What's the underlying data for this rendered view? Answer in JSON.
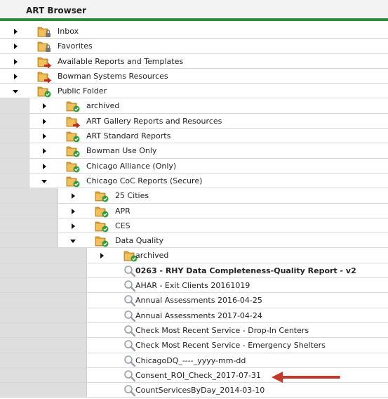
{
  "header": {
    "title": "ART Browser"
  },
  "colors": {
    "accent": "#2f8a3a",
    "annotation_arrow": "#c0392b"
  },
  "tree": [
    {
      "label": "Inbox",
      "level": 0,
      "toggle": "collapsed",
      "icon": "folder-lock-icon"
    },
    {
      "label": "Favorites",
      "level": 0,
      "toggle": "collapsed",
      "icon": "folder-lock-icon"
    },
    {
      "label": "Available Reports and Templates",
      "level": 0,
      "toggle": "collapsed",
      "icon": "folder-redarrow-icon"
    },
    {
      "label": "Bowman Systems Resources",
      "level": 0,
      "toggle": "collapsed",
      "icon": "folder-redarrow-icon"
    },
    {
      "label": "Public Folder",
      "level": 0,
      "toggle": "expanded",
      "icon": "folder-check-icon"
    },
    {
      "label": "archived",
      "level": 1,
      "toggle": "collapsed",
      "icon": "folder-check-icon"
    },
    {
      "label": "ART Gallery Reports and Resources",
      "level": 1,
      "toggle": "collapsed",
      "icon": "folder-redarrow-icon"
    },
    {
      "label": "ART Standard Reports",
      "level": 1,
      "toggle": "collapsed",
      "icon": "folder-check-icon"
    },
    {
      "label": "Bowman Use Only",
      "level": 1,
      "toggle": "collapsed",
      "icon": "folder-check-icon"
    },
    {
      "label": "Chicago Alliance (Only)",
      "level": 1,
      "toggle": "collapsed",
      "icon": "folder-check-icon"
    },
    {
      "label": "Chicago CoC Reports (Secure)",
      "level": 1,
      "toggle": "expanded",
      "icon": "folder-check-icon"
    },
    {
      "label": "25 Cities",
      "level": 2,
      "toggle": "collapsed",
      "icon": "folder-check-icon"
    },
    {
      "label": "APR",
      "level": 2,
      "toggle": "collapsed",
      "icon": "folder-check-icon"
    },
    {
      "label": "CES",
      "level": 2,
      "toggle": "collapsed",
      "icon": "folder-check-icon"
    },
    {
      "label": "Data Quality",
      "level": 2,
      "toggle": "expanded",
      "icon": "folder-check-icon"
    },
    {
      "label": "archived",
      "level": 3,
      "toggle": "collapsed",
      "icon": "folder-check-icon"
    },
    {
      "label": "0263 - RHY Data Completeness-Quality Report - v2",
      "level": 3,
      "toggle": "none",
      "icon": "magnifier-icon",
      "bold": true
    },
    {
      "label": "AHAR - Exit Clients 20161019",
      "level": 3,
      "toggle": "none",
      "icon": "magnifier-icon"
    },
    {
      "label": "Annual Assessments 2016-04-25",
      "level": 3,
      "toggle": "none",
      "icon": "magnifier-icon"
    },
    {
      "label": "Annual Assessments 2017-04-24",
      "level": 3,
      "toggle": "none",
      "icon": "magnifier-icon"
    },
    {
      "label": "Check Most Recent Service - Drop-In Centers",
      "level": 3,
      "toggle": "none",
      "icon": "magnifier-icon"
    },
    {
      "label": "Check Most Recent Service - Emergency Shelters",
      "level": 3,
      "toggle": "none",
      "icon": "magnifier-icon"
    },
    {
      "label": "ChicagoDQ_----_yyyy-mm-dd",
      "level": 3,
      "toggle": "none",
      "icon": "magnifier-icon"
    },
    {
      "label": "Consent_ROI_Check_2017-07-31",
      "level": 3,
      "toggle": "none",
      "icon": "magnifier-icon"
    },
    {
      "label": "CountServicesByDay_2014-03-10",
      "level": 3,
      "toggle": "none",
      "icon": "magnifier-icon"
    }
  ]
}
